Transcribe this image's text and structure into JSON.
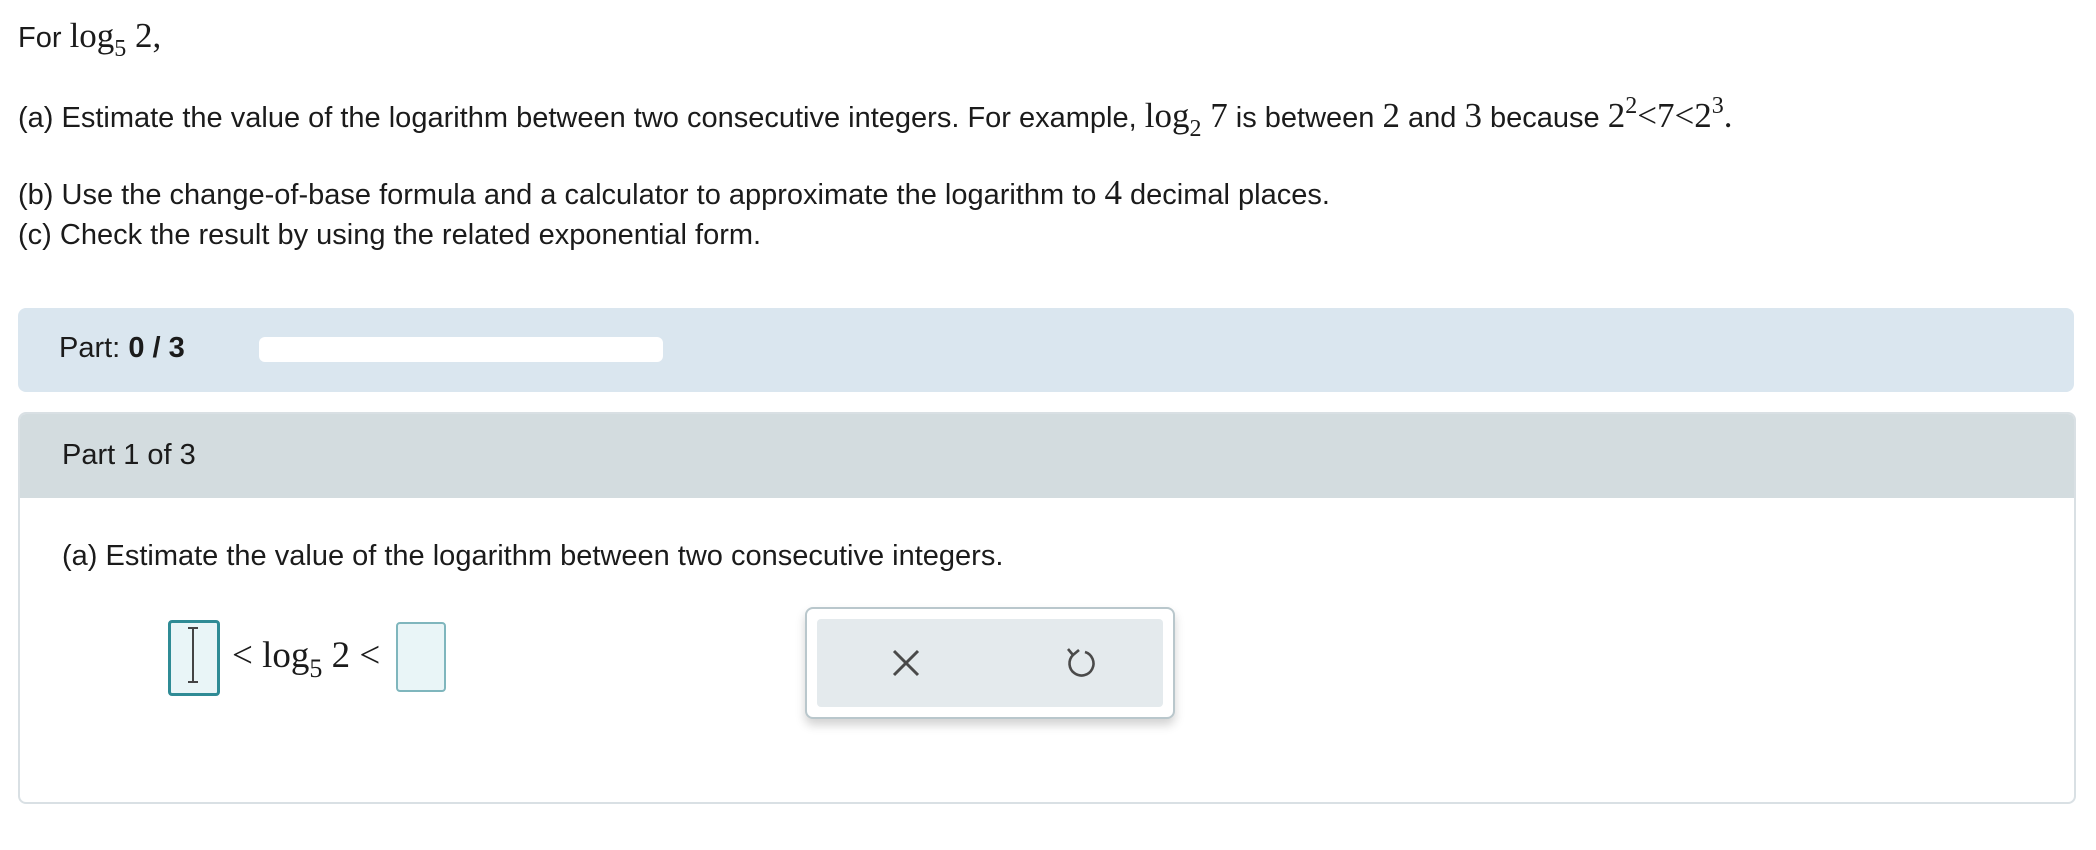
{
  "problem": {
    "intro": {
      "prefix": "For ",
      "log": "log",
      "base": "5",
      "arg": " 2,"
    },
    "part_a": {
      "text1": "(a) Estimate the value of the logarithm between two consecutive integers. For example, ",
      "log": "log",
      "base": "2",
      "arg": " 7",
      "text2": " is between ",
      "n1": "2",
      "text3": " and ",
      "n2": "3",
      "text4": " because ",
      "base1": "2",
      "exp1": "2",
      "mid": "<7<",
      "base2": "2",
      "exp2": "3",
      "end": "."
    },
    "part_b": {
      "text1": "(b) Use the change-of-base formula and a calculator to approximate the logarithm to ",
      "num": "4",
      "text2": " decimal places."
    },
    "part_c": "(c) Check the result by using the related exponential form."
  },
  "progress": {
    "label": "Part: ",
    "value": "0 / 3",
    "fraction": 0
  },
  "part_card": {
    "header": "Part 1 of 3",
    "question": "(a) Estimate the value of the logarithm between two consecutive integers.",
    "expression": {
      "lt1": "< ",
      "log": "log",
      "base": "5",
      "arg": " 2",
      "lt2": " <"
    },
    "left_value": "",
    "right_value": ""
  },
  "tools": {
    "clear_icon": "close-icon",
    "undo_icon": "undo-icon"
  },
  "colors": {
    "accent": "#2f8b95",
    "progress_bg": "#dae6ef",
    "header_bg": "#d3dcdf"
  }
}
